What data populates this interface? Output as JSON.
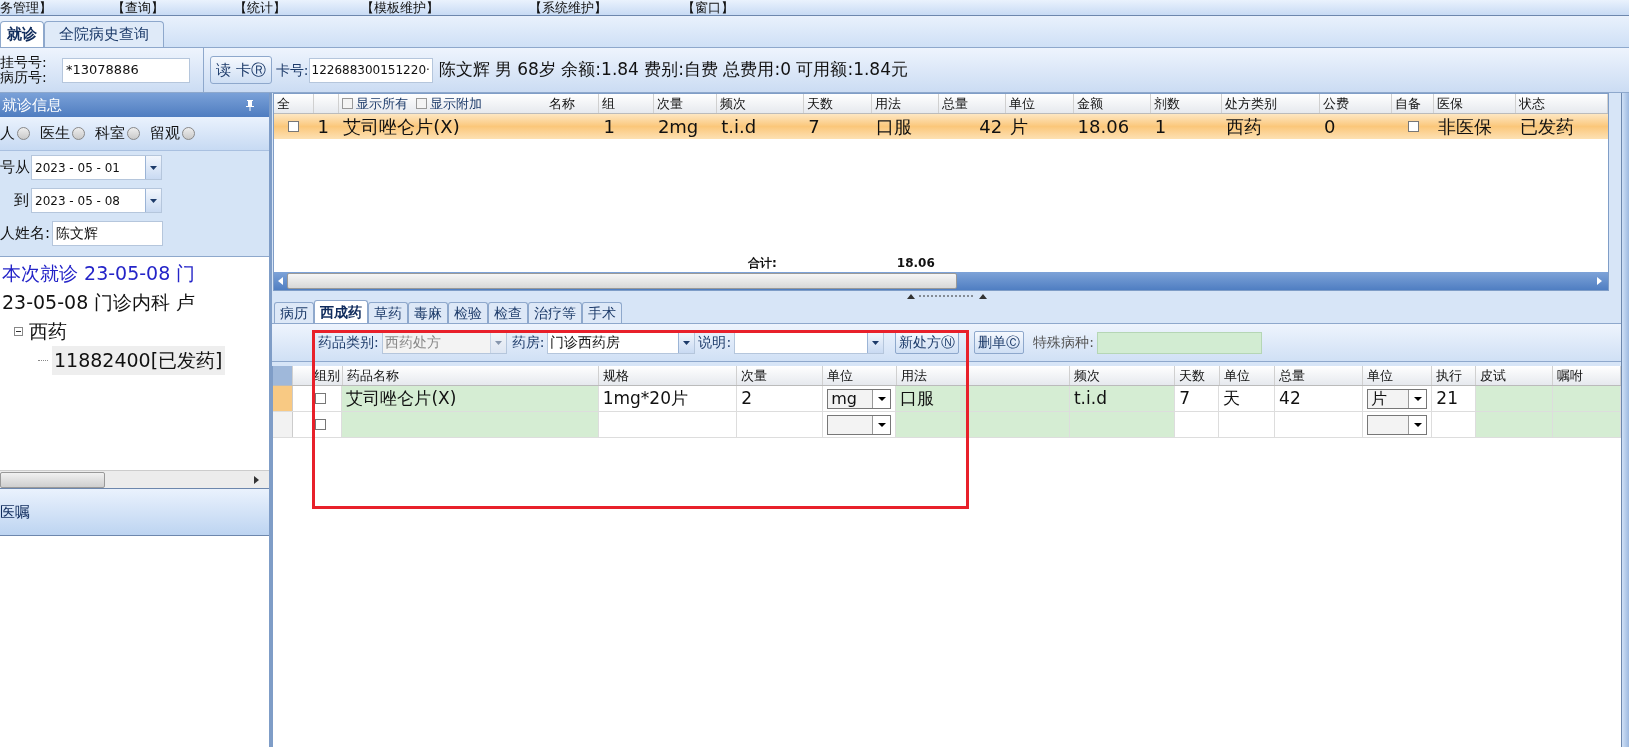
{
  "menu": [
    "务管理】",
    "【查询】",
    "【统计】",
    "【模板维护】",
    "【系统维护】",
    "【窗口】"
  ],
  "tabs": [
    {
      "label": "就诊",
      "selected": true
    },
    {
      "label": "全院病史查询",
      "selected": false
    }
  ],
  "patient_bar": {
    "reg_label": "挂号号:",
    "record_label": "病历号:",
    "record_no": "*13078886",
    "read_card_button": "读 卡Ⓡ",
    "card_label": "卡号:",
    "card_no": "122688300151220·",
    "info": "陈文辉 男 68岁 余额:1.84 费别:自费 总费用:0 可用额:1.84元"
  },
  "left_panel": {
    "title": "就诊信息",
    "filters": [
      {
        "label": "人",
        "selected": false
      },
      {
        "label": "医生",
        "selected": false
      },
      {
        "label": "科室",
        "selected": false
      },
      {
        "label": "留观",
        "selected": false
      }
    ],
    "date_from_label": "号从",
    "date_from": "2023 - 05 - 01",
    "date_to_label": "到",
    "date_to": "2023 - 05 - 08",
    "name_label": "人姓名:",
    "name": "陈文辉",
    "tree": [
      {
        "label": "本次就诊 23-05-08 门",
        "current": true
      },
      {
        "label": "23-05-08 门诊内科 卢",
        "current": false,
        "children": [
          {
            "label": "西药",
            "current": false,
            "expanded": true,
            "children": [
              {
                "label": "11882400[已发药]",
                "current": false,
                "selected": true
              }
            ]
          }
        ]
      }
    ],
    "bottom_title": "医嘱"
  },
  "orders": {
    "columns": [
      "全",
      "名称",
      "组",
      "次量",
      "频次",
      "天数",
      "用法",
      "总量",
      "单位",
      "金额",
      "剂数",
      "处方类别",
      "公费",
      "自备",
      "医保",
      "状态"
    ],
    "filters": [
      {
        "label": "显示所有",
        "checked": false
      },
      {
        "label": "显示附加",
        "checked": false
      }
    ],
    "rows": [
      {
        "selected": true,
        "checked": false,
        "no": "1",
        "name": "艾司唑仑片(X)",
        "group": "1",
        "dose": "2mg",
        "freq": "t.i.d",
        "days": "7",
        "route": "口服",
        "total": "42",
        "unit": "片",
        "amount": "18.06",
        "doses": "1",
        "rx_type": "西药",
        "public_fee": "0",
        "self_supplied": false,
        "insurance": "非医保",
        "status": "已发药"
      }
    ],
    "total_label": "合计:",
    "total_value": "18.06"
  },
  "rx_tabs": [
    {
      "label": "病历",
      "selected": false
    },
    {
      "label": "西成药",
      "selected": true
    },
    {
      "label": "草药",
      "selected": false
    },
    {
      "label": "毒麻",
      "selected": false
    },
    {
      "label": "检验",
      "selected": false
    },
    {
      "label": "检查",
      "selected": false
    },
    {
      "label": "治疗等",
      "selected": false
    },
    {
      "label": "手术",
      "selected": false
    }
  ],
  "rx_toolbar": {
    "category_label": "药品类别:",
    "category": "西药处方",
    "category_disabled": true,
    "pharmacy_label": "药房:",
    "pharmacy": "门诊西药房",
    "note_label": "说明:",
    "new_button": "新处方Ⓝ",
    "delete_button": "删单Ⓒ",
    "special_label": "特殊病种:"
  },
  "rx_grid": {
    "columns": [
      {
        "label": "组别",
        "shaded": false
      },
      {
        "label": "药品名称",
        "shaded": true
      },
      {
        "label": "规格",
        "shaded": false
      },
      {
        "label": "次量",
        "shaded": false
      },
      {
        "label": "单位",
        "shaded": false
      },
      {
        "label": "用法",
        "shaded": true
      },
      {
        "label": "频次",
        "shaded": true
      },
      {
        "label": "天数",
        "shaded": false
      },
      {
        "label": "单位",
        "shaded": false
      },
      {
        "label": "总量",
        "shaded": false
      },
      {
        "label": "单位",
        "shaded": false
      },
      {
        "label": "执行",
        "shaded": false
      },
      {
        "label": "皮试",
        "shaded": true
      },
      {
        "label": "嘱咐",
        "shaded": true
      }
    ],
    "rows": [
      {
        "current": true,
        "group_checked": false,
        "name": "艾司唑仑片(X)",
        "spec": "1mg*20片",
        "dose": "2",
        "dose_unit": "mg",
        "route": "口服",
        "freq": "t.i.d",
        "days": "7",
        "days_unit": "天",
        "total": "42",
        "total_unit": "片",
        "exec": "21"
      },
      {
        "current": false,
        "group_checked": false
      }
    ]
  }
}
